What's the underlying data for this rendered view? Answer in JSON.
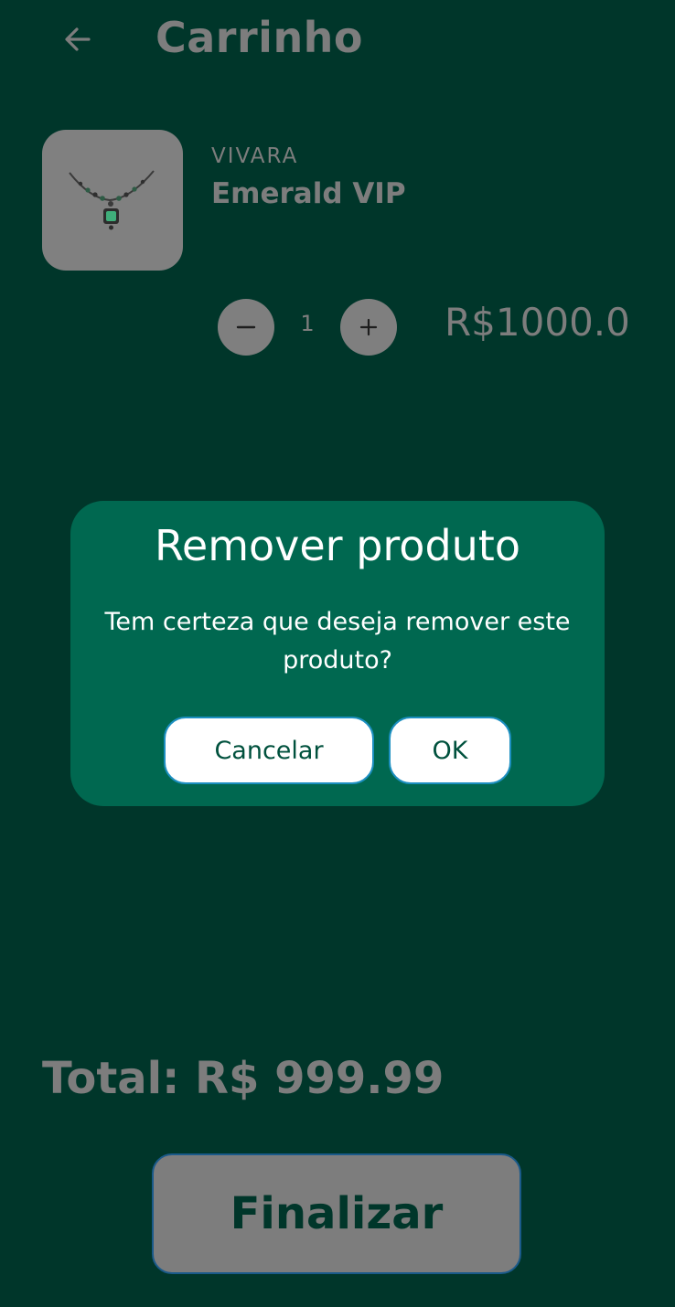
{
  "header": {
    "title": "Carrinho",
    "back_icon": "arrow-left-icon"
  },
  "cart": {
    "items": [
      {
        "brand": "VIVARA",
        "name": "Emerald VIP",
        "quantity": "1",
        "price": "R$1000.0",
        "image_icon": "emerald-necklace-image"
      }
    ],
    "total_label": "Total: R$ 999.99",
    "finalize_label": "Finalizar"
  },
  "dialog": {
    "title": "Remover produto",
    "message": "Tem certeza que deseja remover este produto?",
    "cancel_label": "Cancelar",
    "ok_label": "OK"
  },
  "colors": {
    "background": "#00362a",
    "dialog": "#006850",
    "muted": "#7d7d7d",
    "button_text": "#00513d"
  }
}
